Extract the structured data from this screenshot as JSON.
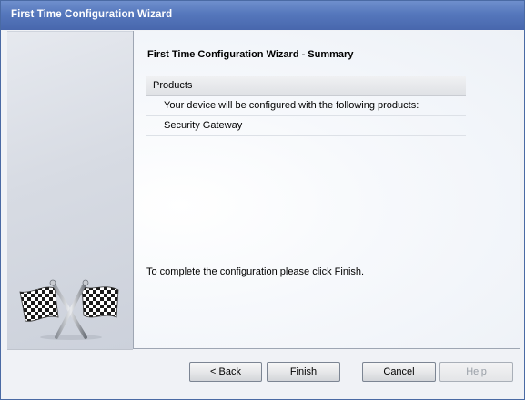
{
  "window": {
    "title": "First Time Configuration Wizard"
  },
  "content": {
    "title": "First Time Configuration Wizard - Summary",
    "products": {
      "header": "Products",
      "rows": [
        "Your device will be configured with the following products:",
        "Security Gateway"
      ]
    },
    "footer_note": "To complete the configuration please click Finish."
  },
  "buttons": {
    "back": "< Back",
    "finish": "Finish",
    "cancel": "Cancel",
    "help": "Help"
  },
  "icons": {
    "wizard_image": "checkered-flags-icon"
  }
}
